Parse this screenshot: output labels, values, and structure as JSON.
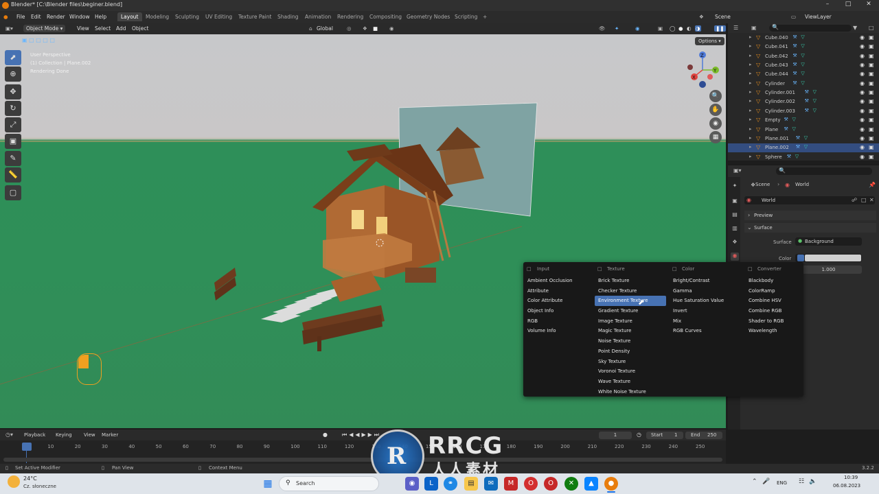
{
  "window": {
    "title": "Blender* [C:\\Blender files\\beginer.blend]",
    "controls": [
      "–",
      "□",
      "✕"
    ]
  },
  "menu": {
    "items": [
      "File",
      "Edit",
      "Render",
      "Window",
      "Help"
    ],
    "workspaces": [
      "Layout",
      "Modeling",
      "Sculpting",
      "UV Editing",
      "Texture Paint",
      "Shading",
      "Animation",
      "Rendering",
      "Compositing",
      "Geometry Nodes",
      "Scripting",
      "+"
    ],
    "active_workspace": "Layout",
    "scene": "Scene",
    "view_layer": "ViewLayer"
  },
  "viewport_header": {
    "mode": "Object Mode",
    "menus": [
      "View",
      "Select",
      "Add",
      "Object"
    ],
    "transform": "Global",
    "options_label": "Options"
  },
  "viewport_info": {
    "line1": "User Perspective",
    "line2": "(1) Collection | Plane.002",
    "line3": "Rendering Done"
  },
  "gizmo_axes": {
    "x": "X",
    "y": "Y",
    "z": "Z"
  },
  "outliner": {
    "rows": [
      {
        "name": "Cube.040",
        "selected": false
      },
      {
        "name": "Cube.041",
        "selected": false
      },
      {
        "name": "Cube.042",
        "selected": false
      },
      {
        "name": "Cube.043",
        "selected": false
      },
      {
        "name": "Cube.044",
        "selected": false
      },
      {
        "name": "Cylinder",
        "selected": false
      },
      {
        "name": "Cylinder.001",
        "selected": false
      },
      {
        "name": "Cylinder.002",
        "selected": false
      },
      {
        "name": "Cylinder.003",
        "selected": false
      },
      {
        "name": "Empty",
        "selected": false
      },
      {
        "name": "Plane",
        "selected": false
      },
      {
        "name": "Plane.001",
        "selected": false
      },
      {
        "name": "Plane.002",
        "selected": true
      },
      {
        "name": "Sphere",
        "selected": false
      }
    ]
  },
  "properties": {
    "breadcrumb_scene": "Scene",
    "breadcrumb_world": "World",
    "world_name": "World",
    "preview_label": "Preview",
    "surface_label": "Surface",
    "surface_field_label": "Surface",
    "surface_value": "Background",
    "color_label": "Color",
    "strength_value": "1.000"
  },
  "add_menu": {
    "columns": [
      {
        "title": "Input",
        "items": [
          "Ambient Occlusion",
          "Attribute",
          "Color Attribute",
          "Object Info",
          "RGB",
          "Volume Info"
        ]
      },
      {
        "title": "Texture",
        "items": [
          "Brick Texture",
          "Checker Texture",
          "Environment Texture",
          "Gradient Texture",
          "Image Texture",
          "Magic Texture",
          "Noise Texture",
          "Point Density",
          "Sky Texture",
          "Voronoi Texture",
          "Wave Texture",
          "White Noise Texture"
        ]
      },
      {
        "title": "Color",
        "items": [
          "Bright/Contrast",
          "Gamma",
          "Hue Saturation Value",
          "Invert",
          "Mix",
          "RGB Curves"
        ]
      },
      {
        "title": "Converter",
        "items": [
          "Blackbody",
          "ColorRamp",
          "Combine HSV",
          "Combine RGB",
          "Shader to RGB",
          "Wavelength"
        ]
      }
    ],
    "highlighted": "Environment Texture"
  },
  "timeline": {
    "menus": [
      "Playback",
      "Keying",
      "View",
      "Marker"
    ],
    "current_frame": "1",
    "start_label": "Start",
    "start_value": "1",
    "end_label": "End",
    "end_value": "250",
    "ticks": [
      "1",
      "10",
      "20",
      "30",
      "40",
      "50",
      "60",
      "70",
      "80",
      "90",
      "100",
      "110",
      "120",
      "130",
      "140",
      "150",
      "160",
      "170",
      "180",
      "190",
      "200",
      "210",
      "220",
      "230",
      "240",
      "250"
    ]
  },
  "statusbar": {
    "left": "Set Active Modifier",
    "middle": "Pan View",
    "right": "Context Menu",
    "version": "3.2.2"
  },
  "watermark": {
    "brand": "RRCG",
    "sub": "人人素材"
  },
  "taskbar": {
    "weather_temp": "24°C",
    "weather_desc": "Cz. słoneczne",
    "search_placeholder": "Search",
    "lang": "ENG",
    "time": "10:39",
    "date": "06.08.2023"
  },
  "colors": {
    "accent": "#4772b3",
    "blender_orange": "#e87d0d",
    "ground": "#2f8f58"
  }
}
